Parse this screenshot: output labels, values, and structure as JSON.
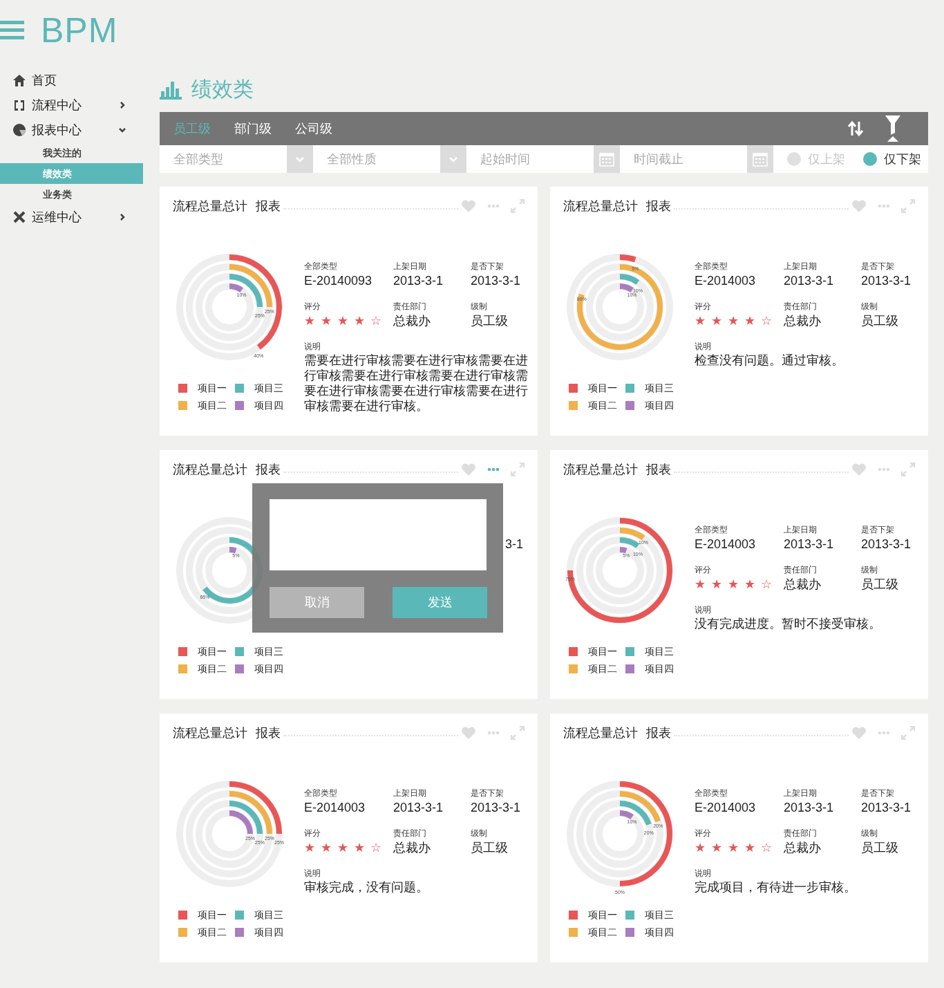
{
  "sidebar": {
    "logo": "BPM",
    "items": [
      {
        "label": "首页",
        "selected": false
      },
      {
        "label": "流程中心",
        "selected": false,
        "expanded": false
      },
      {
        "label": "报表中心",
        "selected": false,
        "expanded": true,
        "children": [
          {
            "label": "我关注的",
            "selected": false
          },
          {
            "label": "绩效类",
            "selected": true
          },
          {
            "label": "业务类",
            "selected": false
          }
        ]
      },
      {
        "label": "运维中心",
        "selected": false,
        "expanded": false
      }
    ]
  },
  "page_title": "绩效类",
  "tabs": [
    {
      "label": "员工级",
      "selected": true
    },
    {
      "label": "部门级",
      "selected": false
    },
    {
      "label": "公司级",
      "selected": false
    }
  ],
  "filters": [
    {
      "kind": "select",
      "placeholder": "全部类型"
    },
    {
      "kind": "select",
      "placeholder": "全部性质"
    },
    {
      "kind": "date",
      "placeholder": "起始时间"
    },
    {
      "kind": "date",
      "placeholder": "时间截止"
    }
  ],
  "radios": [
    {
      "label": "仅上架",
      "selected": false
    },
    {
      "label": "仅下架",
      "selected": true
    }
  ],
  "cards": [
    {
      "title": "流程总量总计",
      "subtitle": "报表",
      "more_active": false,
      "rings": [
        {
          "kind": "labeled",
          "label": "40%"
        },
        {
          "kind": "labeled",
          "label": "25%"
        },
        {
          "kind": "labeled",
          "label": "25%"
        },
        {
          "kind": "labeled",
          "label": "10%"
        }
      ],
      "legend": [
        {
          "label": "项目一",
          "color": "#e85656"
        },
        {
          "label": "项目二",
          "color": "#f0b04a"
        },
        {
          "label": "项目三",
          "color": "#5bb8b8"
        },
        {
          "label": "项目四",
          "color": "#a97cc0"
        }
      ],
      "rows": [
        [
          {
            "kind": "text",
            "label": "全部类型",
            "value": "E-20140093"
          },
          {
            "kind": "text",
            "label": "上架日期",
            "value": "2013-3-1"
          },
          {
            "kind": "text",
            "label": "是否下架",
            "value": "2013-3-1"
          }
        ],
        [
          {
            "kind": "stars",
            "label": "评分",
            "stars": 4
          },
          {
            "kind": "text",
            "label": "责任部门",
            "value": "总裁办"
          },
          {
            "kind": "text",
            "label": "级制",
            "value": "员工级"
          }
        ]
      ],
      "note_label": "说明",
      "note": "需要在进行审核需要在进行审核需要在进行审核需要在进行审核需要在进行审核需要在进行审核需要在进行审核需要在进行审核需要在进行审核。"
    },
    {
      "title": "流程总量总计",
      "subtitle": "报表",
      "more_active": false,
      "rings": [
        {
          "kind": "labeled",
          "label": "5%"
        },
        {
          "kind": "labeled",
          "label": "80%"
        },
        {
          "kind": "labeled",
          "label": "10%"
        },
        {
          "kind": "labeled",
          "label": "10%"
        }
      ],
      "legend": [
        {
          "label": "项目一",
          "color": "#e85656"
        },
        {
          "label": "项目二",
          "color": "#f0b04a"
        },
        {
          "label": "项目三",
          "color": "#5bb8b8"
        },
        {
          "label": "项目四",
          "color": "#a97cc0"
        }
      ],
      "rows": [
        [
          {
            "kind": "text",
            "label": "全部类型",
            "value": "E-2014003"
          },
          {
            "kind": "text",
            "label": "上架日期",
            "value": "2013-3-1"
          },
          {
            "kind": "text",
            "label": "是否下架",
            "value": "2013-3-1"
          }
        ],
        [
          {
            "kind": "stars",
            "label": "评分",
            "stars": 4
          },
          {
            "kind": "text",
            "label": "责任部门",
            "value": "总裁办"
          },
          {
            "kind": "text",
            "label": "级制",
            "value": "员工级"
          }
        ]
      ],
      "note_label": "说明",
      "note": "检查没有问题。通过审核。"
    },
    {
      "title": "流程总量总计",
      "subtitle": "报表",
      "more_active": true,
      "rings": [
        {
          "kind": "covered"
        },
        {
          "kind": "covered"
        },
        {
          "kind": "labeled",
          "label": "65%"
        },
        {
          "kind": "labeled",
          "label": "5%"
        }
      ],
      "legend": [
        {
          "label": "项目一",
          "color": "#e85656"
        },
        {
          "label": "项目二",
          "color": "#f0b04a"
        },
        {
          "label": "项目三",
          "color": "#5bb8b8"
        },
        {
          "label": "项目四",
          "color": "#a97cc0"
        }
      ],
      "rows": [
        [
          {
            "kind": "text",
            "value": "3-1"
          }
        ]
      ],
      "dialog": {
        "cancel": "取消",
        "send": "发送"
      }
    },
    {
      "title": "流程总量总计",
      "subtitle": "报表",
      "more_active": false,
      "rings": [
        {
          "kind": "labeled",
          "label": "75%"
        },
        {
          "kind": "labeled",
          "label": "10%"
        },
        {
          "kind": "labeled",
          "label": "10%"
        },
        {
          "kind": "labeled",
          "label": "5%"
        }
      ],
      "legend": [
        {
          "label": "项目一",
          "color": "#e85656"
        },
        {
          "label": "项目二",
          "color": "#f0b04a"
        },
        {
          "label": "项目三",
          "color": "#5bb8b8"
        },
        {
          "label": "项目四",
          "color": "#a97cc0"
        }
      ],
      "rows": [
        [
          {
            "kind": "text",
            "label": "全部类型",
            "value": "E-2014003"
          },
          {
            "kind": "text",
            "label": "上架日期",
            "value": "2013-3-1"
          },
          {
            "kind": "text",
            "label": "是否下架",
            "value": "2013-3-1"
          }
        ],
        [
          {
            "kind": "stars",
            "label": "评分",
            "stars": 4
          },
          {
            "kind": "text",
            "label": "责任部门",
            "value": "总裁办"
          },
          {
            "kind": "text",
            "label": "级制",
            "value": "员工级"
          }
        ]
      ],
      "note_label": "说明",
      "note": "没有完成进度。暂时不接受审核。"
    },
    {
      "title": "流程总量总计",
      "subtitle": "报表",
      "more_active": false,
      "rings": [
        {
          "kind": "labeled",
          "label": "25%"
        },
        {
          "kind": "labeled",
          "label": "25%"
        },
        {
          "kind": "labeled",
          "label": "25%"
        },
        {
          "kind": "labeled",
          "label": "25%"
        }
      ],
      "legend": [
        {
          "label": "项目一",
          "color": "#e85656"
        },
        {
          "label": "项目二",
          "color": "#f0b04a"
        },
        {
          "label": "项目三",
          "color": "#5bb8b8"
        },
        {
          "label": "项目四",
          "color": "#a97cc0"
        }
      ],
      "rows": [
        [
          {
            "kind": "text",
            "label": "全部类型",
            "value": "E-2014003"
          },
          {
            "kind": "text",
            "label": "上架日期",
            "value": "2013-3-1"
          },
          {
            "kind": "text",
            "label": "是否下架",
            "value": "2013-3-1"
          }
        ],
        [
          {
            "kind": "stars",
            "label": "评分",
            "stars": 4
          },
          {
            "kind": "text",
            "label": "责任部门",
            "value": "总裁办"
          },
          {
            "kind": "text",
            "label": "级制",
            "value": "员工级"
          }
        ]
      ],
      "note_label": "说明",
      "note": "审核完成，没有问题。"
    },
    {
      "title": "流程总量总计",
      "subtitle": "报表",
      "more_active": false,
      "rings": [
        {
          "kind": "labeled",
          "label": "50%"
        },
        {
          "kind": "labeled",
          "label": "20%"
        },
        {
          "kind": "labeled",
          "label": "20%"
        },
        {
          "kind": "labeled",
          "label": "10%"
        }
      ],
      "legend": [
        {
          "label": "项目一",
          "color": "#e85656"
        },
        {
          "label": "项目二",
          "color": "#f0b04a"
        },
        {
          "label": "项目三",
          "color": "#5bb8b8"
        },
        {
          "label": "项目四",
          "color": "#a97cc0"
        }
      ],
      "rows": [
        [
          {
            "kind": "text",
            "label": "全部类型",
            "value": "E-2014003"
          },
          {
            "kind": "text",
            "label": "上架日期",
            "value": "2013-3-1"
          },
          {
            "kind": "text",
            "label": "是否下架",
            "value": "2013-3-1"
          }
        ],
        [
          {
            "kind": "stars",
            "label": "评分",
            "stars": 4
          },
          {
            "kind": "text",
            "label": "责任部门",
            "value": "总裁办"
          },
          {
            "kind": "text",
            "label": "级制",
            "value": "员工级"
          }
        ]
      ],
      "note_label": "说明",
      "note": "完成项目，有待进一步审核。"
    }
  ]
}
